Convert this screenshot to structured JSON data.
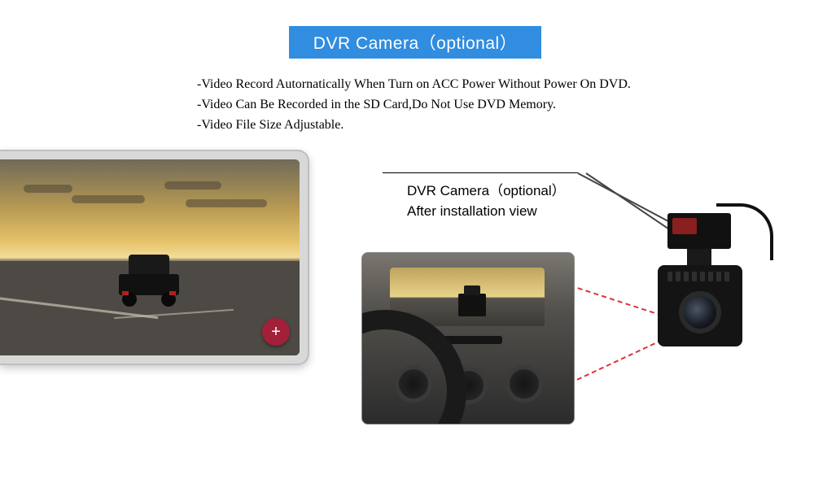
{
  "title": "DVR Camera（optional）",
  "bullets": {
    "b1": "-Video Record Autornatically When Turn on ACC Power Without Power On DVD.",
    "b2": "-Video Can Be Recorded in the SD Card,Do Not Use DVD Memory.",
    "b3": "-Video File Size Adjustable."
  },
  "callout": {
    "line1": "DVR Camera（optional）",
    "line2": "After installation view"
  },
  "plus_icon": "+"
}
